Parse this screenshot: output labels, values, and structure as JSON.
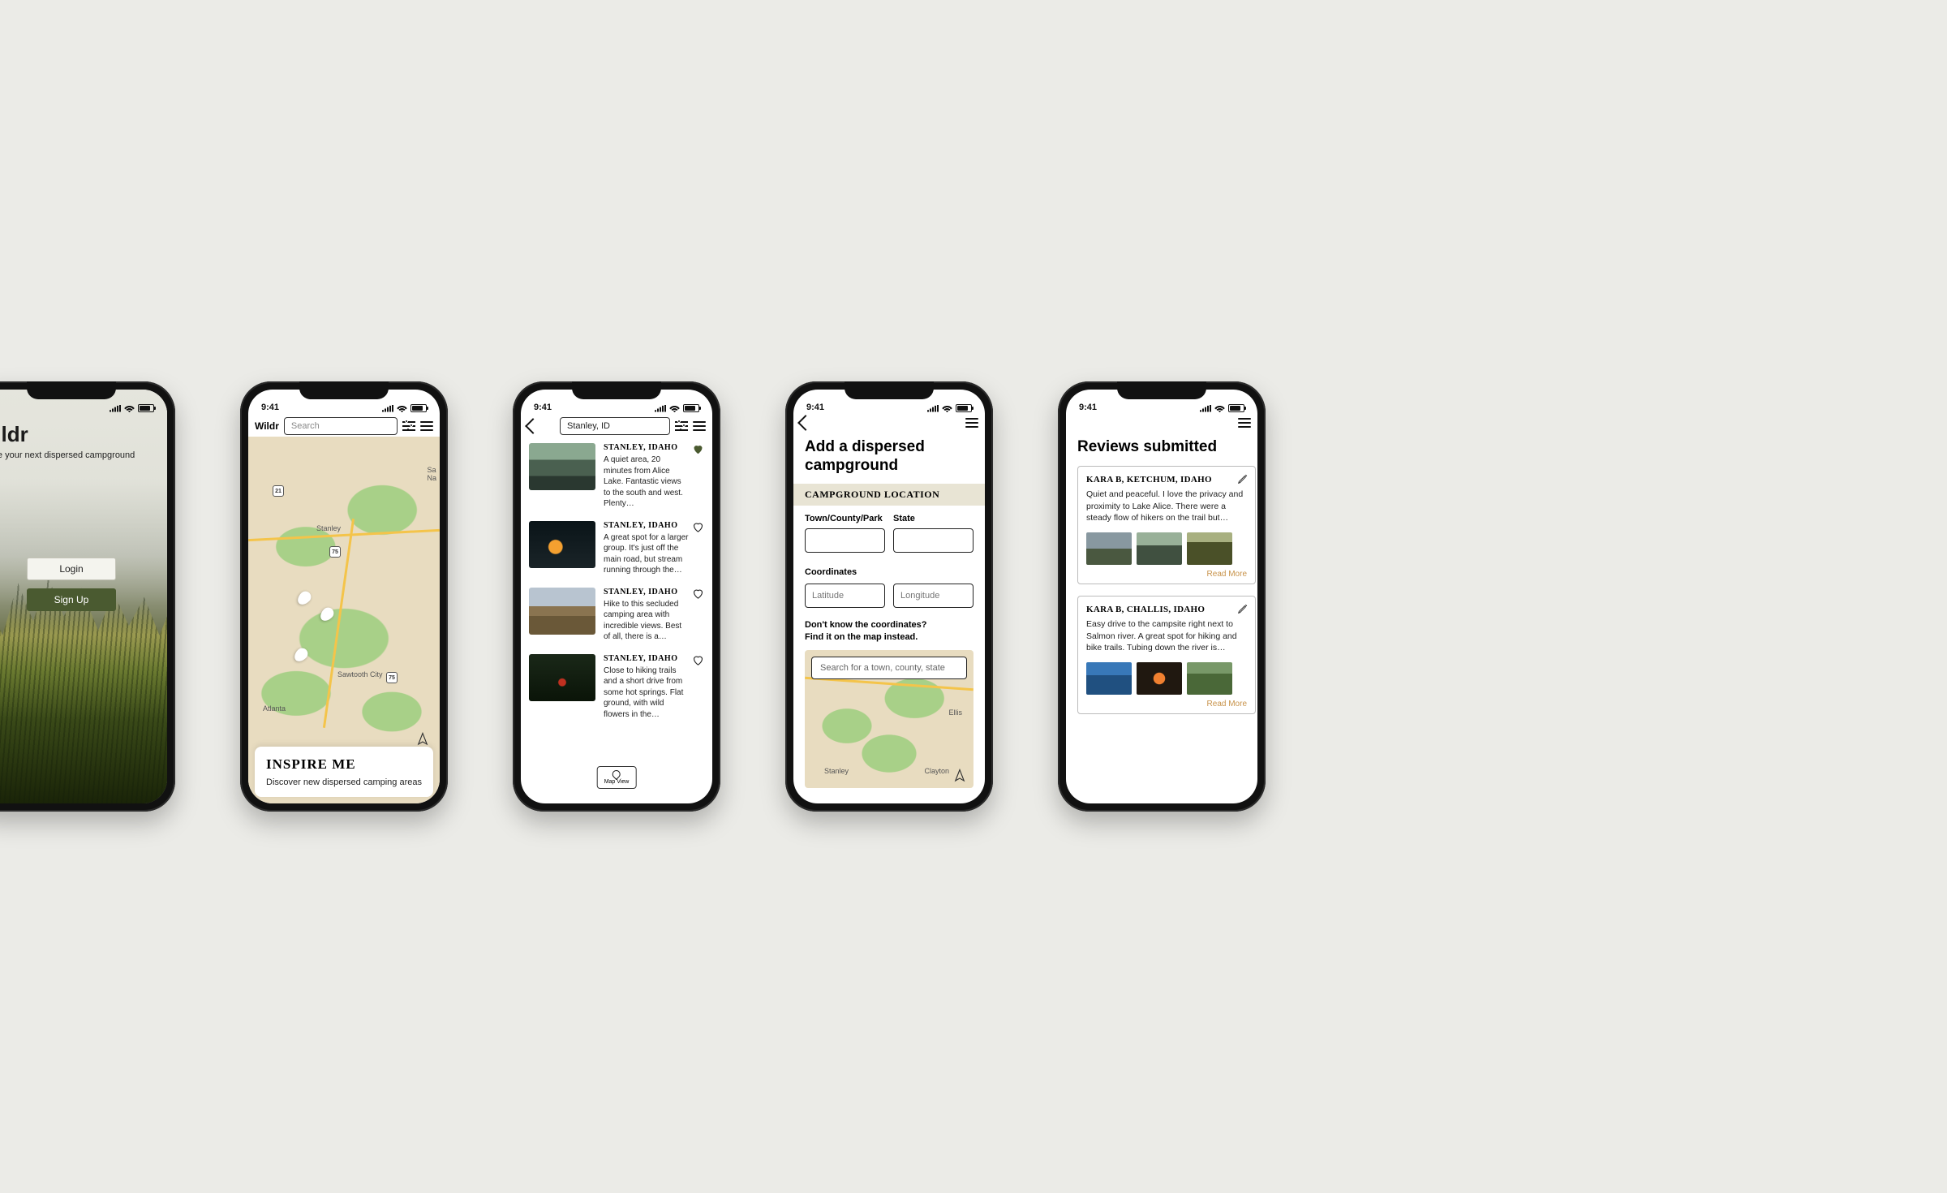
{
  "status": {
    "time": "9:41"
  },
  "screen1": {
    "title": "Wildr",
    "tagline": "Locate your next dispersed campground",
    "login": "Login",
    "signup": "Sign Up"
  },
  "screen2": {
    "brand": "Wildr",
    "search_placeholder": "Search",
    "towns": {
      "stanley": "Stanley",
      "sawtooth": "Sawtooth City",
      "atlanta": "Atlanta",
      "sana": "Sa\nNa"
    },
    "shields": {
      "r21": "21",
      "r75a": "75",
      "r75b": "75"
    },
    "inspire_title": "INSPIRE ME",
    "inspire_sub": "Discover new dispersed camping areas"
  },
  "screen3": {
    "search_value": "Stanley, ID",
    "items": [
      {
        "loc": "STANLEY, IDAHO",
        "desc": "A quiet area, 20 minutes from Alice Lake. Fantastic views to the south and west. Plenty…",
        "fav": true
      },
      {
        "loc": "STANLEY, IDAHO",
        "desc": "A great spot for a larger group. It's just off the main road, but stream running through the…",
        "fav": false
      },
      {
        "loc": "STANLEY, IDAHO",
        "desc": "Hike to this secluded camping area with incredible views. Best of all, there is a…",
        "fav": false
      },
      {
        "loc": "STANLEY, IDAHO",
        "desc": "Close to hiking trails and a short drive from some hot springs. Flat ground, with wild flowers in the…",
        "fav": false
      }
    ],
    "mapview": "Map View"
  },
  "screen4": {
    "title": "Add a dispersed campground",
    "section": "CAMPGROUND LOCATION",
    "town_label": "Town/County/Park",
    "state_label": "State",
    "coords_label": "Coordinates",
    "lat_ph": "Latitude",
    "lon_ph": "Longitude",
    "hint1": "Don't know the coordinates?",
    "hint2": "Find it on the map instead.",
    "map_search_ph": "Search for a town, county, state",
    "towns": {
      "stanley": "Stanley",
      "clayton": "Clayton",
      "ellis": "Ellis"
    }
  },
  "screen5": {
    "title": "Reviews submitted",
    "reviews": [
      {
        "head": "KARA B, KETCHUM, IDAHO",
        "body": "Quiet and peaceful. I love the privacy and proximity to Lake Alice. There were a steady flow of hikers on the trail but…",
        "more": "Read More"
      },
      {
        "head": "KARA B, CHALLIS, IDAHO",
        "body": "Easy drive to the campsite right next to Salmon river. A great spot for hiking and bike trails. Tubing down the river is…",
        "more": "Read More"
      }
    ]
  }
}
